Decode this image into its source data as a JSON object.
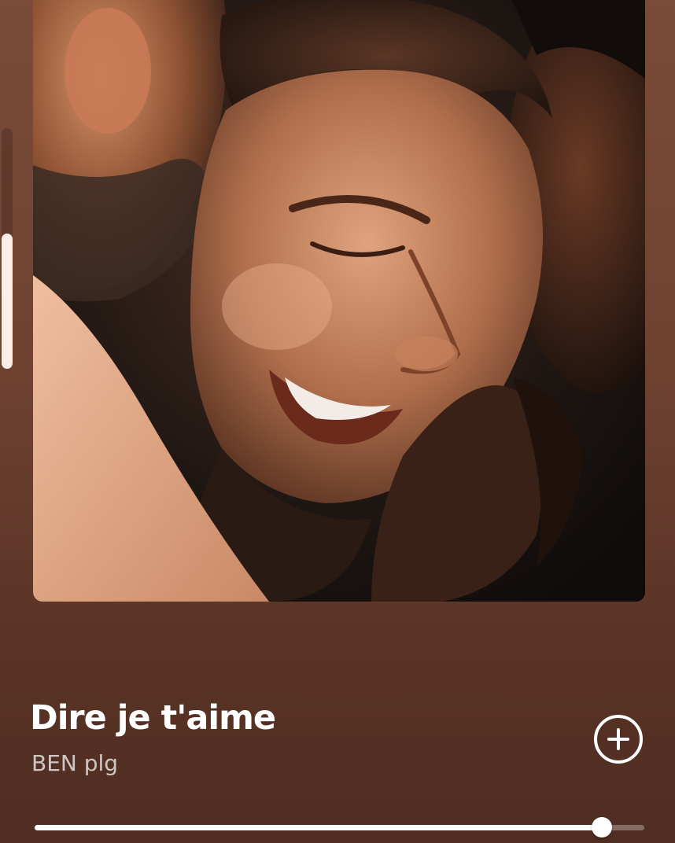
{
  "now_playing": {
    "title": "Dire je t'aime",
    "artist": "BEN plg",
    "progress_fraction": 0.93
  },
  "story_progress": {
    "fraction": 0.56
  },
  "artwork": {
    "subject": "smiling-man-portrait"
  },
  "icons": {
    "add": "plus-circle-icon"
  },
  "colors": {
    "background_top": "#7a4b38",
    "background_bottom": "#4f2d22",
    "text_primary": "#ffffff",
    "text_secondary": "#d9c9c1",
    "accent": "#ffffff"
  }
}
